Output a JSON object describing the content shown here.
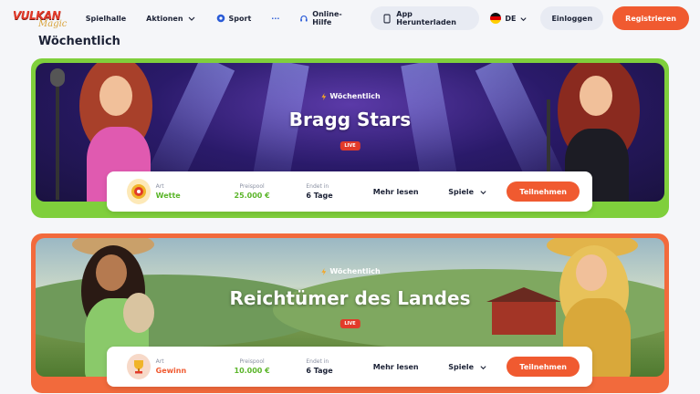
{
  "header": {
    "logo_text": "VULKAN",
    "logo_sub": "Magic",
    "nav": [
      {
        "label": "Spielhalle"
      },
      {
        "label": "Aktionen"
      },
      {
        "label": "Sport"
      },
      {
        "label": "···"
      }
    ],
    "help_label": "Online-Hilfe",
    "app_label": "App Herunterladen",
    "lang_label": "DE",
    "login_label": "Einloggen",
    "register_label": "Registrieren"
  },
  "section_title": "Wöchentlich",
  "tournaments": [
    {
      "tag": "Wöchentlich",
      "title": "Bragg Stars",
      "live": "LIVE",
      "type_label": "Art",
      "type_value": "Wette",
      "pool_label": "Preispool",
      "pool_value": "25.000 €",
      "ends_label": "Endet in",
      "ends_value": "6 Tage",
      "more_label": "Mehr lesen",
      "games_label": "Spiele",
      "join_label": "Teilnehmen"
    },
    {
      "tag": "Wöchentlich",
      "title": "Reichtümer des Landes",
      "live": "LIVE",
      "type_label": "Art",
      "type_value": "Gewinn",
      "pool_label": "Preispool",
      "pool_value": "10.000 €",
      "ends_label": "Endet in",
      "ends_value": "6 Tage",
      "more_label": "Mehr lesen",
      "games_label": "Spiele",
      "join_label": "Teilnehmen"
    }
  ],
  "colors": {
    "accent": "#f05a30",
    "card1_border": "#7fcf3c",
    "card2_border": "#f26a3c",
    "value_green": "#5bb52a",
    "live_red": "#e23a2a"
  }
}
